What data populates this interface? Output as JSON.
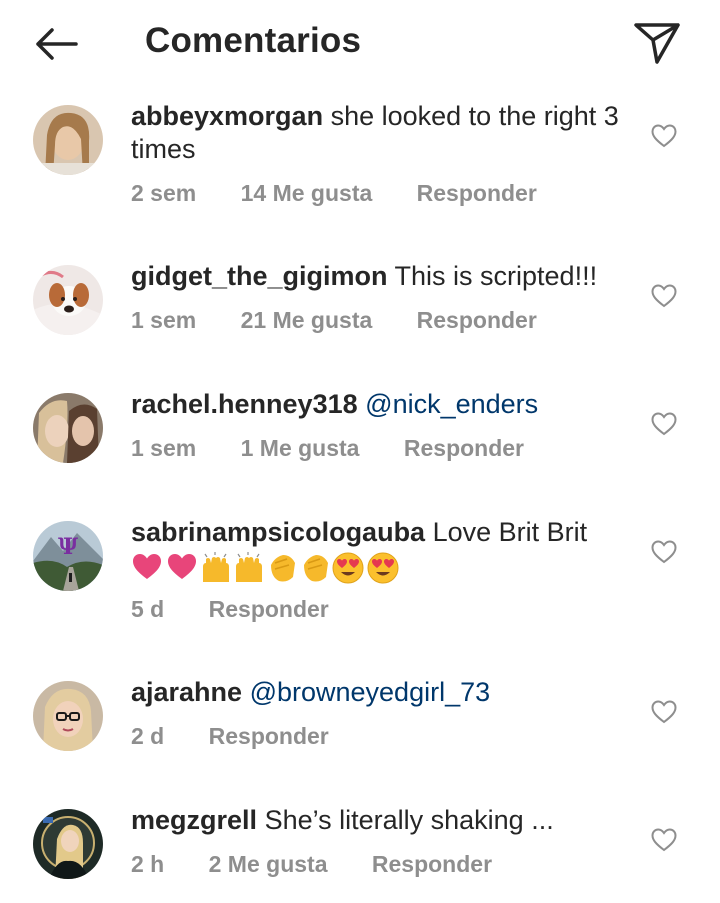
{
  "header": {
    "title": "Comentarios"
  },
  "comments": [
    {
      "username": "abbeyxmorgan",
      "text": "she looked to the right 3 times",
      "time": "2 sem",
      "likes": "14 Me gusta",
      "reply": "Responder"
    },
    {
      "username": "gidget_the_gigimon",
      "text": "This is scripted!!!",
      "time": "1 sem",
      "likes": "21 Me gusta",
      "reply": "Responder"
    },
    {
      "username": "rachel.henney318",
      "mention": "@nick_enders",
      "time": "1 sem",
      "likes": "1 Me gusta",
      "reply": "Responder"
    },
    {
      "username": "sabrinampsicologauba",
      "text": "Love Brit Brit",
      "emojis": [
        "heart-emoji",
        "heart-emoji",
        "raising-hands-emoji",
        "raising-hands-emoji",
        "clapping-hands-emoji",
        "clapping-hands-emoji",
        "heart-eyes-emoji",
        "heart-eyes-emoji"
      ],
      "time": "5 d",
      "reply": "Responder"
    },
    {
      "username": "ajarahne",
      "mention": "@browneyedgirl_73",
      "time": "2 d",
      "reply": "Responder"
    },
    {
      "username": "megzgrell",
      "text": "She’s literally shaking ...",
      "time": "2 h",
      "likes": "2 Me gusta",
      "reply": "Responder"
    }
  ],
  "colors": {
    "text": "#262626",
    "secondary": "#8e8e8e",
    "mention": "#00376b",
    "background": "#ffffff"
  }
}
